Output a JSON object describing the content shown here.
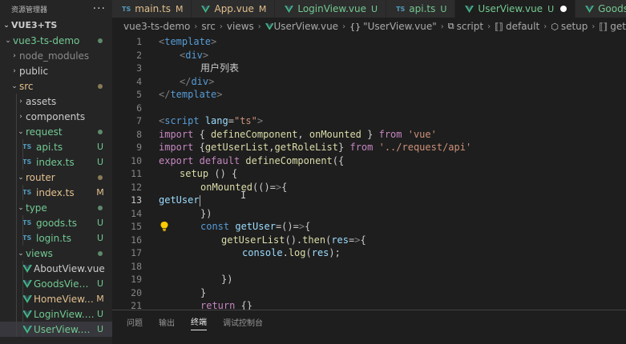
{
  "sidebar": {
    "title": "资源管理器",
    "more_icon": "ellipsis-icon",
    "root_label": "VUE3+TS",
    "items": [
      {
        "label": "vue3-ts-demo",
        "kind": "folder-open",
        "status": "dot-green"
      },
      {
        "label": "node_modules",
        "kind": "folder",
        "status": ""
      },
      {
        "label": "public",
        "kind": "folder",
        "status": ""
      },
      {
        "label": "src",
        "kind": "folder-open",
        "status": "dot-orange"
      },
      {
        "label": "assets",
        "kind": "folder",
        "status": ""
      },
      {
        "label": "components",
        "kind": "folder",
        "status": ""
      },
      {
        "label": "request",
        "kind": "folder-open",
        "status": "dot-green"
      },
      {
        "label": "api.ts",
        "kind": "ts",
        "status": "U"
      },
      {
        "label": "index.ts",
        "kind": "ts",
        "status": "U"
      },
      {
        "label": "router",
        "kind": "folder-open",
        "status": "dot-orange"
      },
      {
        "label": "index.ts",
        "kind": "ts",
        "status": "M"
      },
      {
        "label": "type",
        "kind": "folder-open",
        "status": "dot-green"
      },
      {
        "label": "goods.ts",
        "kind": "ts",
        "status": "U"
      },
      {
        "label": "login.ts",
        "kind": "ts",
        "status": "U"
      },
      {
        "label": "views",
        "kind": "folder-open",
        "status": "dot-green"
      },
      {
        "label": "AboutView.vue",
        "kind": "vue",
        "status": ""
      },
      {
        "label": "GoodsView....",
        "kind": "vue",
        "status": "U"
      },
      {
        "label": "HomeView....",
        "kind": "vue",
        "status": "M"
      },
      {
        "label": "LoginView.vue",
        "kind": "vue",
        "status": "U"
      },
      {
        "label": "UserView.vue",
        "kind": "vue",
        "status": "U"
      }
    ]
  },
  "tabs": [
    {
      "label": "main.ts",
      "kind": "ts",
      "badge": "M",
      "active": false
    },
    {
      "label": "App.vue",
      "kind": "vue",
      "badge": "M",
      "active": false
    },
    {
      "label": "LoginView.vue",
      "kind": "vue",
      "badge": "U",
      "active": false
    },
    {
      "label": "api.ts",
      "kind": "ts",
      "badge": "U",
      "active": false
    },
    {
      "label": "UserView.vue",
      "kind": "vue",
      "badge": "U",
      "active": true
    },
    {
      "label": "GoodsVie",
      "kind": "vue",
      "badge": "",
      "active": false
    }
  ],
  "breadcrumb": {
    "parts": [
      "vue3-ts-demo",
      "src",
      "views",
      "UserView.vue",
      "\"UserView.vue\"",
      "script",
      "default",
      "setup",
      "get"
    ]
  },
  "editor": {
    "current_line": 13,
    "lines": [
      {
        "n": "1",
        "text": "<template>"
      },
      {
        "n": "2",
        "text": "<div>"
      },
      {
        "n": "3",
        "text": "用户列表"
      },
      {
        "n": "4",
        "text": "</div>"
      },
      {
        "n": "5",
        "text": "</template>"
      },
      {
        "n": "6",
        "text": ""
      },
      {
        "n": "7",
        "text": "<script lang=\"ts\">"
      },
      {
        "n": "8",
        "text": "import { defineComponent, onMounted } from 'vue'"
      },
      {
        "n": "9",
        "text": "import {getUserList,getRoleList} from '../request/api'"
      },
      {
        "n": "10",
        "text": "export default defineComponent({"
      },
      {
        "n": "11",
        "text": "setup () {"
      },
      {
        "n": "12",
        "text": "onMounted(()=>{"
      },
      {
        "n": "13",
        "text": "getUser"
      },
      {
        "n": "14",
        "text": "})"
      },
      {
        "n": "15",
        "text": "const getUser=()=>{"
      },
      {
        "n": "16",
        "text": "getUserList().then(res=>{"
      },
      {
        "n": "17",
        "text": "console.log(res);"
      },
      {
        "n": "18",
        "text": ""
      },
      {
        "n": "19",
        "text": "})"
      },
      {
        "n": "20",
        "text": "}"
      },
      {
        "n": "21",
        "text": "return {}"
      }
    ]
  },
  "panel": {
    "tabs": [
      "问题",
      "输出",
      "终端",
      "调试控制台"
    ],
    "active_tab": "终端"
  },
  "colors": {
    "accent_tag": "#569cd6",
    "string": "#ce9178",
    "keyword": "#c586c0",
    "function": "#dcdcaa",
    "git_untracked": "#73c991",
    "git_modified": "#e2c08d",
    "ts_icon": "#519aba",
    "vue_icon": "#41b883"
  }
}
